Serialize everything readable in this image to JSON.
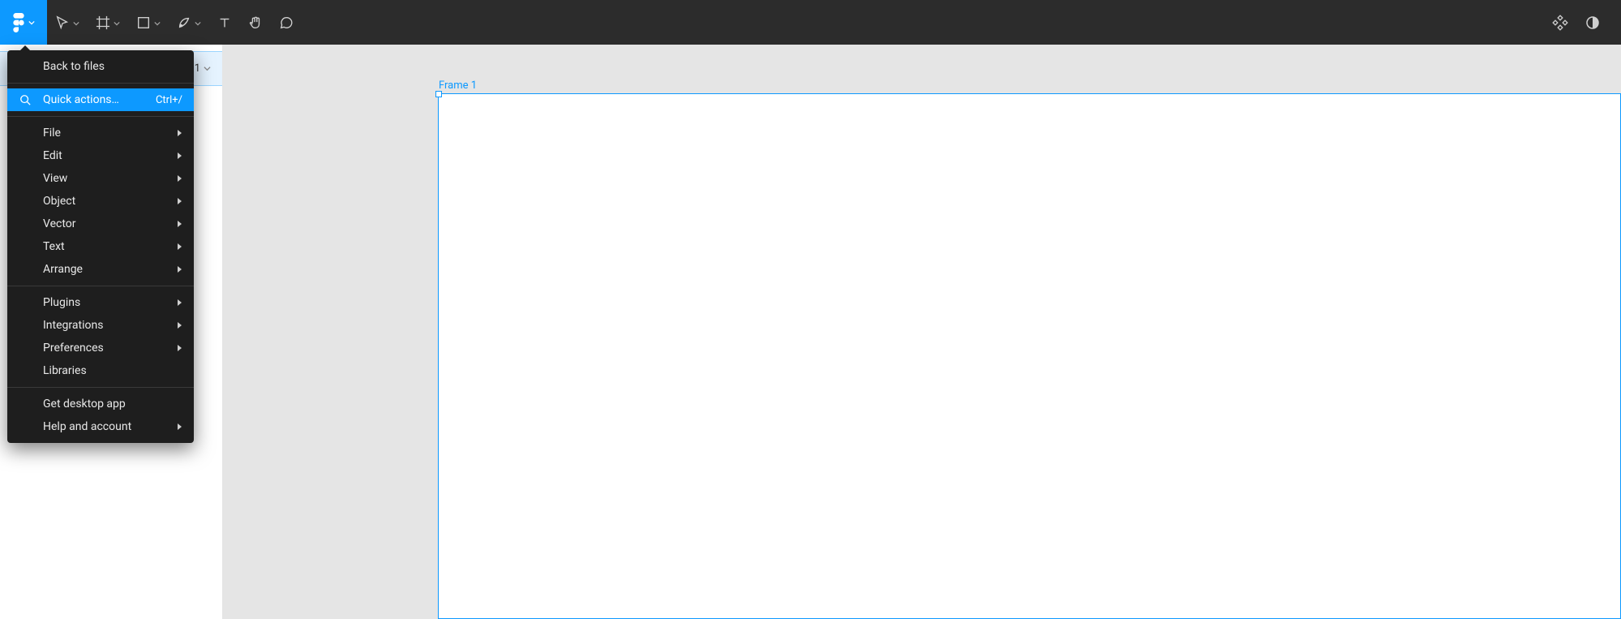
{
  "toolbar": {
    "tools": [
      {
        "name": "move",
        "has_chev": true
      },
      {
        "name": "frame",
        "has_chev": true
      },
      {
        "name": "shape",
        "has_chev": true
      },
      {
        "name": "pen",
        "has_chev": true
      },
      {
        "name": "text",
        "has_chev": false
      },
      {
        "name": "hand",
        "has_chev": false
      },
      {
        "name": "comment",
        "has_chev": false
      }
    ],
    "right_icons": [
      {
        "name": "components-icon"
      },
      {
        "name": "dark-mode-icon"
      }
    ]
  },
  "left_panel": {
    "selected_layer_label": "1"
  },
  "canvas": {
    "frame_label": "Frame 1"
  },
  "menu": {
    "back_to_files": "Back to files",
    "quick_actions_label": "Quick actions…",
    "quick_actions_shortcut": "Ctrl+/",
    "groups": [
      [
        {
          "label": "File",
          "submenu": true
        },
        {
          "label": "Edit",
          "submenu": true
        },
        {
          "label": "View",
          "submenu": true
        },
        {
          "label": "Object",
          "submenu": true
        },
        {
          "label": "Vector",
          "submenu": true
        },
        {
          "label": "Text",
          "submenu": true
        },
        {
          "label": "Arrange",
          "submenu": true
        }
      ],
      [
        {
          "label": "Plugins",
          "submenu": true
        },
        {
          "label": "Integrations",
          "submenu": true
        },
        {
          "label": "Preferences",
          "submenu": true
        },
        {
          "label": "Libraries",
          "submenu": false
        }
      ],
      [
        {
          "label": "Get desktop app",
          "submenu": false
        },
        {
          "label": "Help and account",
          "submenu": true
        }
      ]
    ]
  }
}
